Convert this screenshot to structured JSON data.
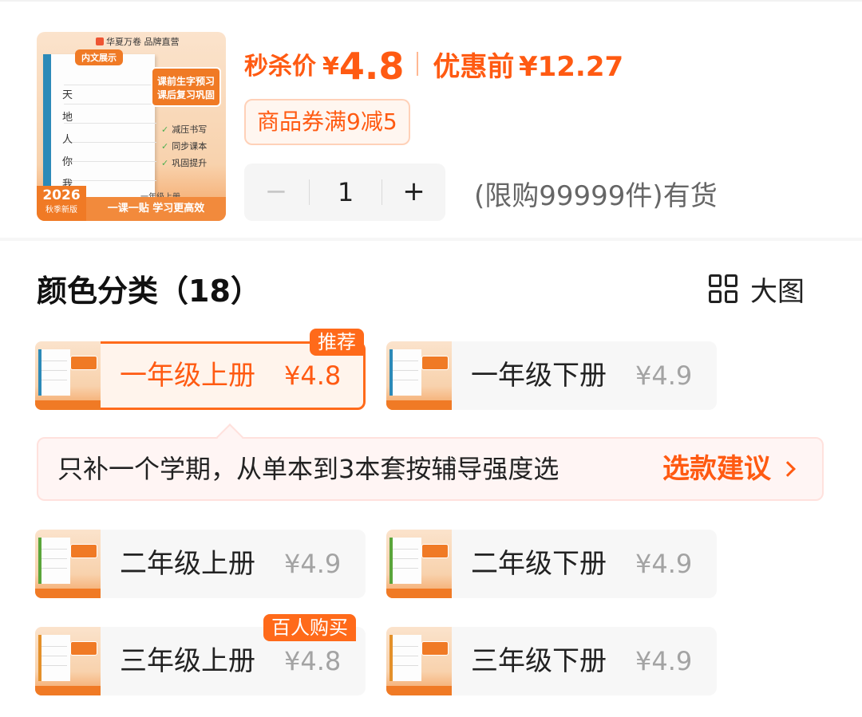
{
  "product": {
    "thumbnail": {
      "brand": "华夏万卷  品牌直营",
      "tag": "内文展示",
      "callout_line1": "课前生字预习",
      "callout_line2": "课后复习巩固",
      "features": [
        "减压书写",
        "同步课本",
        "巩固提升"
      ],
      "sample_chars": [
        "天",
        "地",
        "人",
        "你",
        "我"
      ],
      "grade": "一年级上册",
      "year": "2026",
      "season": "秋季新版",
      "slogan": "一课一贴 学习更高效"
    },
    "flash_label": "秒杀价",
    "currency": "¥",
    "flash_price": "4.8",
    "original_label": "优惠前",
    "original_price": "¥12.27",
    "coupon": "商品券满9减5",
    "quantity": "1",
    "minus_label": "−",
    "plus_label": "+",
    "stock_text": "(限购99999件)有货"
  },
  "section": {
    "title": "颜色分类（18）",
    "big_view_label": "大图"
  },
  "variants": [
    {
      "name": "一年级上册",
      "price": "¥4.8",
      "badge": "推荐",
      "selected": true
    },
    {
      "name": "一年级下册",
      "price": "¥4.9",
      "badge": "",
      "selected": false
    },
    {
      "name": "二年级上册",
      "price": "¥4.9",
      "badge": "",
      "selected": false
    },
    {
      "name": "二年级下册",
      "price": "¥4.9",
      "badge": "",
      "selected": false
    },
    {
      "name": "三年级上册",
      "price": "¥4.8",
      "badge": "百人购买",
      "selected": false
    },
    {
      "name": "三年级下册",
      "price": "¥4.9",
      "badge": "",
      "selected": false
    }
  ],
  "tip": {
    "message": "只补一个学期，从单本到3本套按辅导强度选",
    "link_label": "选款建议"
  },
  "colors": {
    "accent": "#ff5a12",
    "badge": "#ff6a1a",
    "muted_price": "#a3a3a3"
  }
}
